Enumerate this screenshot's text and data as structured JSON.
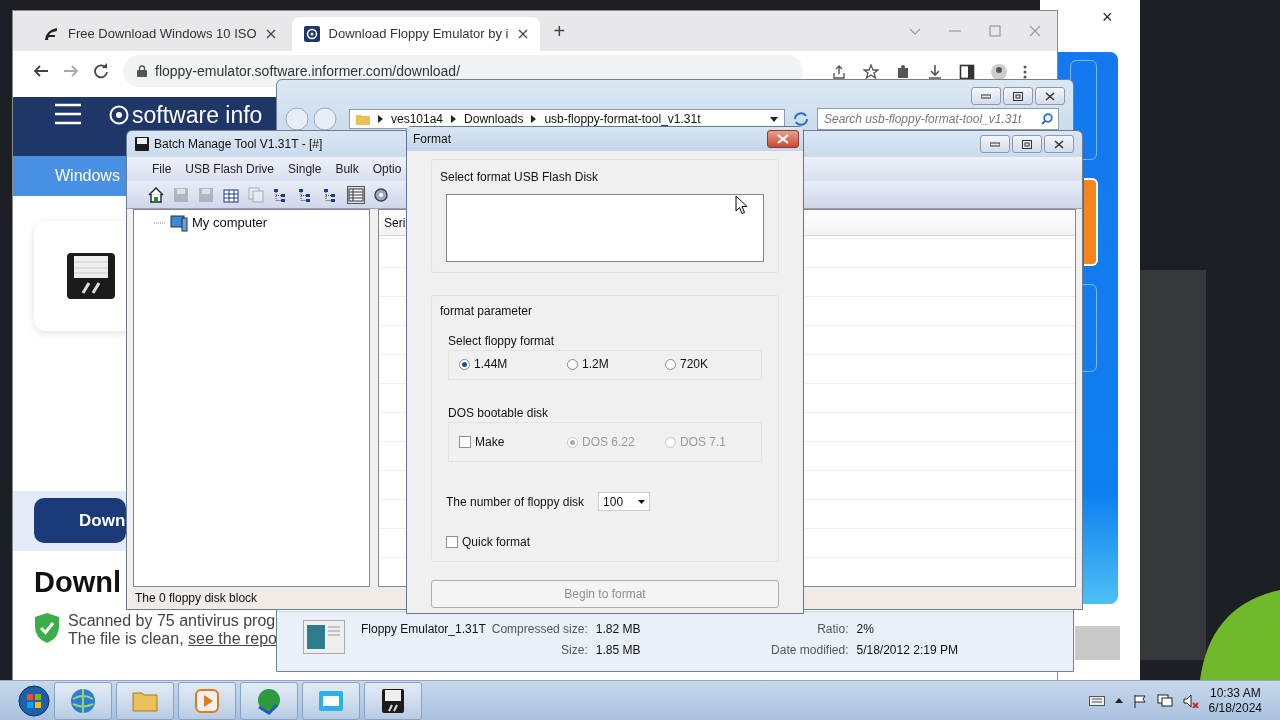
{
  "back_window": {
    "close": "×"
  },
  "browser": {
    "tabs": [
      {
        "title": "Free Download Windows 10 ISO",
        "selected": false
      },
      {
        "title": "Download Floppy Emulator by i",
        "selected": true
      }
    ],
    "new_tab": "+",
    "url": "floppy-emulator.software.informer.com/download/",
    "logo": "software info",
    "nav_item": "Windows",
    "download_button": "Down",
    "heading": "Downl",
    "scan_text": "Scanned by 75 antivirus prog",
    "clean_text": "The file is clean,",
    "report_link": "see the repo"
  },
  "explorer": {
    "breadcrumb": [
      "ves101a4",
      "Downloads",
      "usb-floppy-format-tool_v1.31t"
    ],
    "search": {
      "placeholder": "Search usb-floppy-format-tool_v1.31t"
    },
    "details": {
      "name": "Floppy Emulator_1.31T",
      "fields": [
        {
          "label": "Compressed size:",
          "value": "1.82 MB"
        },
        {
          "label": "Ratio:",
          "value": "2%"
        },
        {
          "label": "Size:",
          "value": "1.85 MB"
        },
        {
          "label": "Date modified:",
          "value": "5/18/2012 2:19 PM"
        }
      ]
    }
  },
  "batch_tool": {
    "title": "Batch Manage Tool V1.31T  - [#]",
    "menu": [
      "File",
      "USB Flash Drive",
      "Single",
      "Bulk",
      "Optio"
    ],
    "toolbar": [
      {
        "kind": "home",
        "disabled": false,
        "selected": false
      },
      {
        "kind": "save",
        "disabled": true,
        "selected": false
      },
      {
        "kind": "save",
        "disabled": true,
        "selected": false
      },
      {
        "kind": "table",
        "disabled": false,
        "selected": false
      },
      {
        "kind": "copy",
        "disabled": true,
        "selected": false
      },
      {
        "kind": "tree",
        "disabled": false,
        "selected": false
      },
      {
        "kind": "tree",
        "disabled": false,
        "selected": false
      },
      {
        "kind": "tree",
        "disabled": false,
        "selected": false
      },
      {
        "kind": "grid",
        "disabled": false,
        "selected": true
      },
      {
        "kind": "settings",
        "disabled": false,
        "selected": false
      }
    ],
    "tree": [
      {
        "label": "My computer"
      }
    ],
    "columns": [
      "Seri"
    ],
    "status": "The 0 floppy disk block"
  },
  "format_dialog": {
    "title": "Format",
    "disk_group": "Select format USB Flash Disk",
    "param_group": "format parameter",
    "floppy_format": {
      "label": "Select floppy format",
      "options": [
        {
          "label": "1.44M",
          "selected": true,
          "disabled": false
        },
        {
          "label": "1.2M",
          "selected": false,
          "disabled": false
        },
        {
          "label": "720K",
          "selected": false,
          "disabled": false
        }
      ]
    },
    "dos_boot": {
      "label": "DOS bootable disk",
      "make": {
        "label": "Make",
        "checked": false
      },
      "options": [
        {
          "label": "DOS 6.22",
          "selected": true,
          "disabled": true
        },
        {
          "label": "DOS 7.1",
          "selected": false,
          "disabled": true
        }
      ]
    },
    "count": {
      "label": "The number of floppy disk",
      "value": "100"
    },
    "quick_format": {
      "label": "Quick format",
      "checked": false
    },
    "begin_button": {
      "label": "Begin to format",
      "disabled": true
    }
  },
  "taskbar": {
    "time": "10:33 AM",
    "date": "6/18/2024"
  }
}
